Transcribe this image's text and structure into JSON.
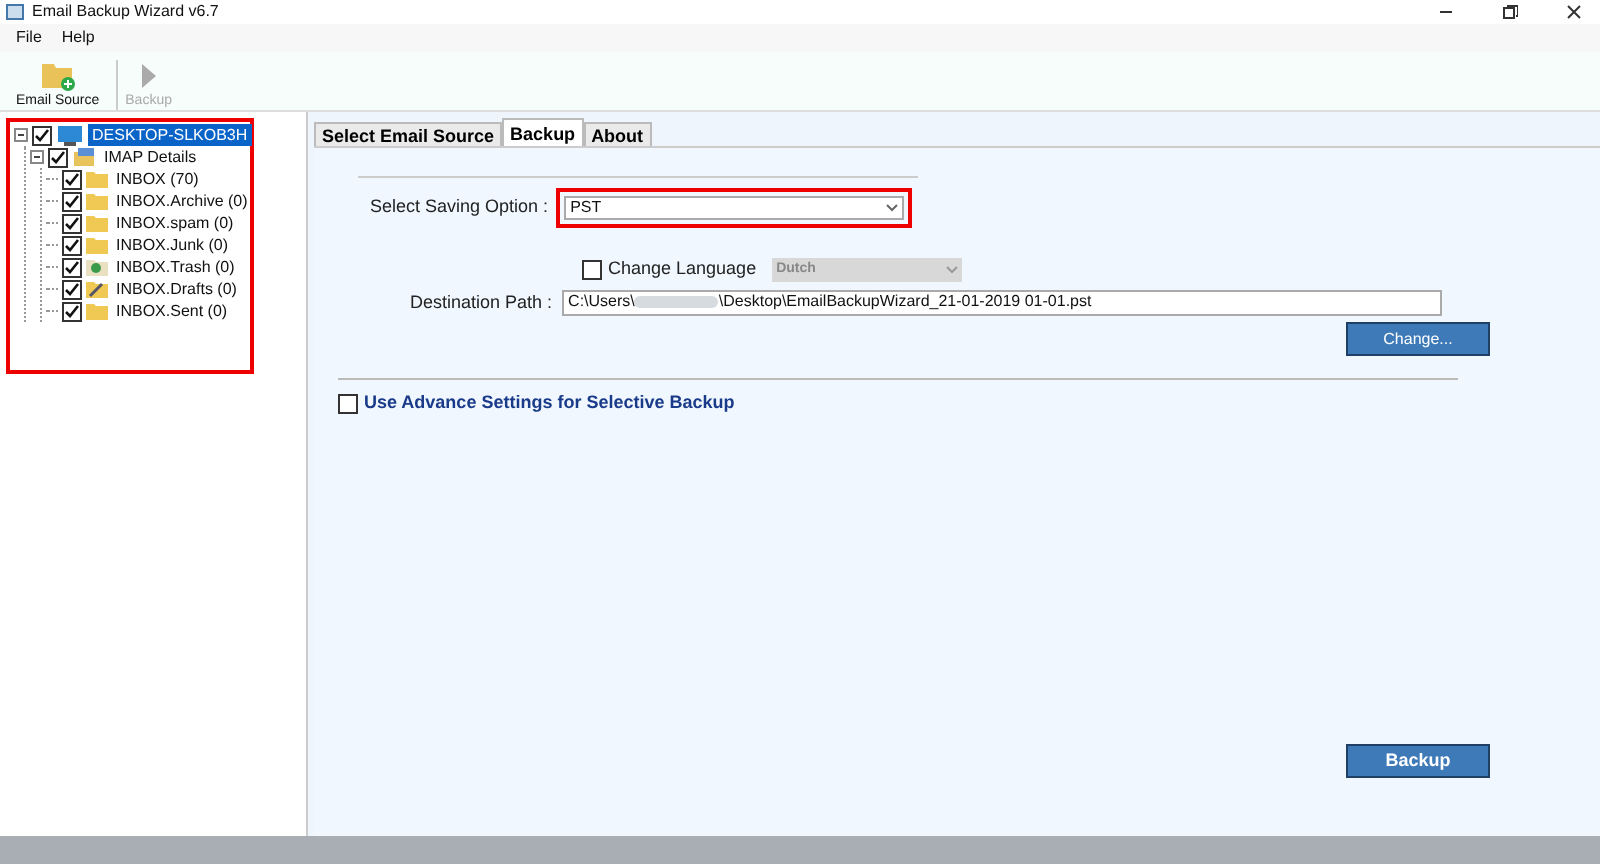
{
  "window": {
    "title": "Email Backup Wizard v6.7"
  },
  "menu": [
    "File",
    "Help"
  ],
  "toolbar": [
    {
      "label": "Email Source",
      "disabled": false
    },
    {
      "label": "Backup",
      "disabled": true
    }
  ],
  "tree": [
    {
      "label": "DESKTOP-SLKOB3H",
      "checked": true,
      "selected": true,
      "kind": "computer",
      "children": [
        {
          "label": "IMAP Details",
          "checked": true,
          "selected": false,
          "kind": "server",
          "children": [
            {
              "label": "INBOX (70)",
              "checked": true,
              "selected": false,
              "kind": "folder"
            },
            {
              "label": "INBOX.Archive (0)",
              "checked": true,
              "selected": false,
              "kind": "folder"
            },
            {
              "label": "INBOX.spam (0)",
              "checked": true,
              "selected": false,
              "kind": "folder"
            },
            {
              "label": "INBOX.Junk (0)",
              "checked": true,
              "selected": false,
              "kind": "folder"
            },
            {
              "label": "INBOX.Trash (0)",
              "checked": true,
              "selected": false,
              "kind": "trash"
            },
            {
              "label": "INBOX.Drafts (0)",
              "checked": true,
              "selected": false,
              "kind": "drafts"
            },
            {
              "label": "INBOX.Sent (0)",
              "checked": true,
              "selected": false,
              "kind": "folder"
            }
          ]
        }
      ]
    }
  ],
  "tabs": [
    {
      "label": "Select Email Source",
      "selected": false
    },
    {
      "label": "Backup",
      "selected": true
    },
    {
      "label": "About",
      "selected": false
    }
  ],
  "saving_option": {
    "label": "Select Saving Option :",
    "value": "PST"
  },
  "change_language": {
    "label": "Change Language",
    "checked": false,
    "value": "Dutch"
  },
  "destination": {
    "label": "Destination Path :",
    "value_start": "C:\\Users\\",
    "value_end": "\\Desktop\\EmailBackupWizard_21-01-2019 01-01.pst"
  },
  "change_button": "Change...",
  "advance_settings": {
    "label": "Use Advance Settings for Selective Backup",
    "checked": false
  },
  "backup_button": "Backup"
}
